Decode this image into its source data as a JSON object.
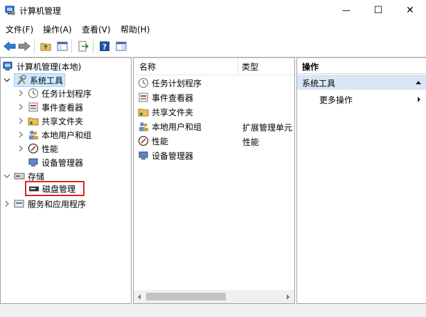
{
  "window": {
    "title": "计算机管理",
    "minimize_glyph": "—",
    "maximize_glyph": "☐",
    "close_glyph": "✕"
  },
  "menu": [
    {
      "label": "文件(F)"
    },
    {
      "label": "操作(A)"
    },
    {
      "label": "查看(V)"
    },
    {
      "label": "帮助(H)"
    }
  ],
  "toolbar": {
    "buttons": [
      "back-arrow-icon",
      "forward-arrow-icon",
      "up-folder-icon",
      "show-tree-icon",
      "export-list-icon",
      "help-icon",
      "properties-icon"
    ]
  },
  "tree": {
    "root": "计算机管理(本地)",
    "system_tools": "系统工具",
    "items": [
      {
        "label": "任务计划程序",
        "icon": "clock-icon"
      },
      {
        "label": "事件查看器",
        "icon": "event-viewer-icon"
      },
      {
        "label": "共享文件夹",
        "icon": "shared-folder-icon"
      },
      {
        "label": "本地用户和组",
        "icon": "users-icon"
      },
      {
        "label": "性能",
        "icon": "performance-icon"
      },
      {
        "label": "设备管理器",
        "icon": "device-manager-icon"
      }
    ],
    "storage": "存储",
    "disk_management": "磁盘管理",
    "services": "服务和应用程序"
  },
  "list": {
    "columns": [
      "名称",
      "类型"
    ],
    "rows": [
      {
        "name": "任务计划程序",
        "type": ""
      },
      {
        "name": "事件查看器",
        "type": ""
      },
      {
        "name": "共享文件夹",
        "type": ""
      },
      {
        "name": "本地用户和组",
        "type": "扩展管理单元"
      },
      {
        "name": "性能",
        "type": "性能"
      },
      {
        "name": "设备管理器",
        "type": ""
      }
    ]
  },
  "actions": {
    "header": "操作",
    "section": "系统工具",
    "more": "更多操作"
  }
}
